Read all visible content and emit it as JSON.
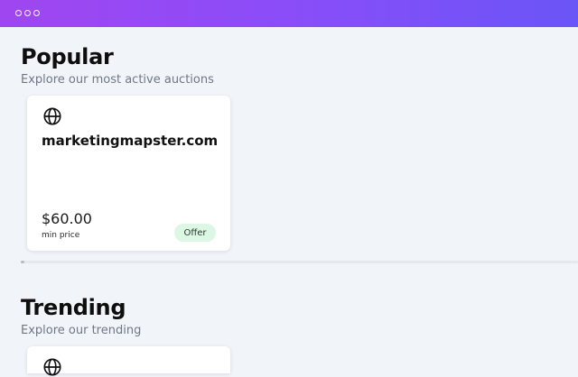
{
  "sections": [
    {
      "title": "Popular",
      "subtitle": "Explore our most active auctions",
      "card": {
        "icon": "globe-icon",
        "domain": "marketingmapster.com",
        "price": "$60.00",
        "price_label": "min price",
        "badge": "Offer",
        "badge_color": "#dcf7e4"
      }
    },
    {
      "title": "Trending",
      "subtitle": "Explore our trending",
      "card": {
        "icon": "globe-icon"
      }
    }
  ],
  "colors": {
    "header_gradient_start": "#a046f0",
    "header_gradient_end": "#6a55f7",
    "page_background": "#f1f4f9"
  }
}
